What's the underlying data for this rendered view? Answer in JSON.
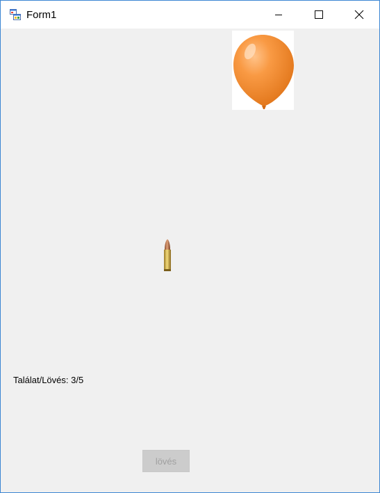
{
  "window": {
    "title": "Form1",
    "icon": "winforms-app-icon",
    "controls": {
      "minimize_icon": "minimize-icon",
      "maximize_icon": "maximize-icon",
      "close_icon": "close-icon"
    },
    "border_color": "#3c86d3"
  },
  "game": {
    "balloon_icon": "balloon-icon",
    "balloon_color": "#f7923a",
    "bullet_icon": "bullet-icon",
    "score": {
      "label": "Találat/Lövés:",
      "value": "3/5"
    },
    "fire_button": {
      "label": "lövés",
      "enabled": false
    }
  }
}
